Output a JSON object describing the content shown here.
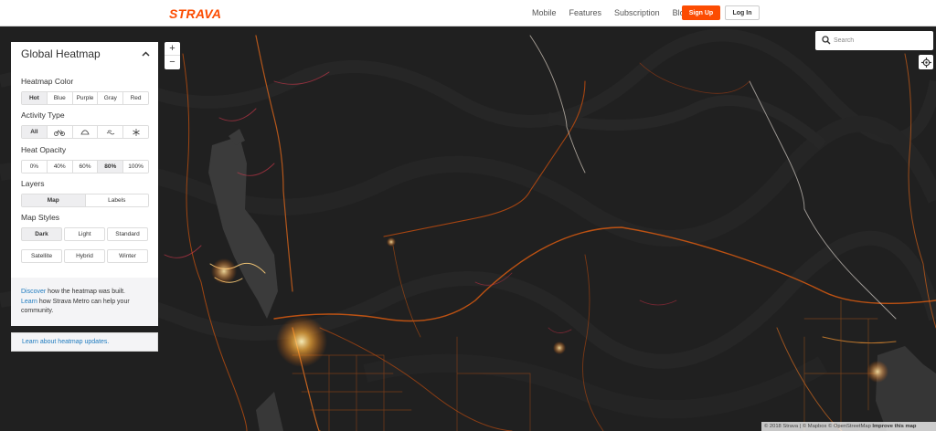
{
  "nav": {
    "logo": "STRAVA",
    "links": [
      "Mobile",
      "Features",
      "Subscription",
      "Blog"
    ],
    "signup": "Sign Up",
    "login": "Log In"
  },
  "zoom": {
    "in": "+",
    "out": "−"
  },
  "search": {
    "placeholder": "Search"
  },
  "panel": {
    "title": "Global Heatmap",
    "heatmap_color": {
      "label": "Heatmap Color",
      "options": [
        "Hot",
        "Blue",
        "Purple",
        "Gray",
        "Red"
      ],
      "selected": "Hot"
    },
    "activity_type": {
      "label": "Activity Type",
      "options": [
        "All"
      ],
      "icons": [
        "bike-icon",
        "run-icon",
        "water-icon",
        "winter-icon"
      ],
      "selected": "All"
    },
    "heat_opacity": {
      "label": "Heat Opacity",
      "options": [
        "0%",
        "40%",
        "60%",
        "80%",
        "100%"
      ],
      "selected": "80%"
    },
    "layers": {
      "label": "Layers",
      "options": [
        "Map",
        "Labels"
      ],
      "selected": "Map"
    },
    "map_styles": {
      "label": "Map Styles",
      "options": [
        "Dark",
        "Light",
        "Standard",
        "Satellite",
        "Hybrid",
        "Winter"
      ],
      "selected": "Dark"
    },
    "footer": {
      "discover_link": "Discover",
      "discover_text": " how the heatmap was built.",
      "learn_link": "Learn",
      "learn_text": " how Strava Metro can help your community."
    }
  },
  "updates_link": "Learn about heatmap updates.",
  "attribution": {
    "text": "© 2018 Strava | © Mapbox © OpenStreetMap ",
    "improve": "Improve this map"
  },
  "colors": {
    "brand": "#fc4c02",
    "link": "#1f7bbf",
    "map_bg": "#222222",
    "heat": "#ff8a1c"
  }
}
